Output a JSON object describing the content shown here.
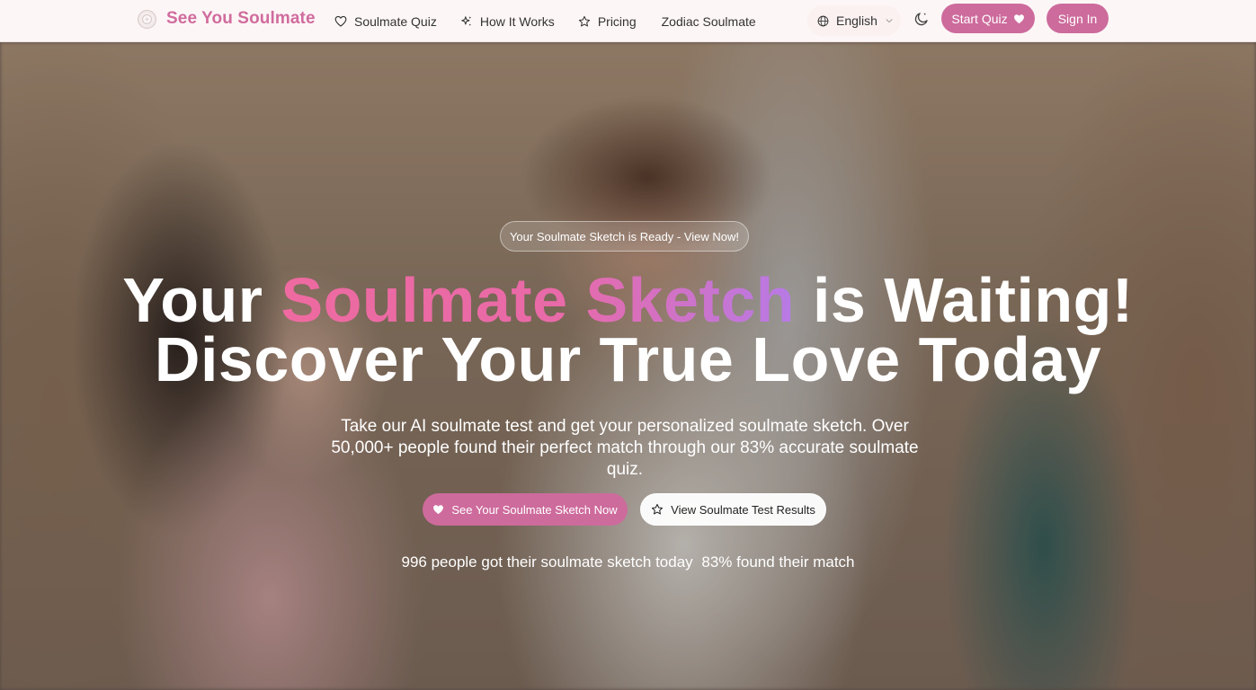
{
  "header": {
    "brand_name": "See You Soulmate",
    "nav": [
      {
        "label": "Soulmate Quiz",
        "icon": "heart-outline-icon"
      },
      {
        "label": "How It Works",
        "icon": "sparkles-icon"
      },
      {
        "label": "Pricing",
        "icon": "star-outline-icon"
      },
      {
        "label": "Zodiac Soulmate",
        "icon": ""
      }
    ],
    "language": "English",
    "start_quiz_label": "Start Quiz",
    "sign_in_label": "Sign In"
  },
  "hero": {
    "badge": "Your Soulmate Sketch is Ready - View Now!",
    "headline": {
      "part1": "Your ",
      "highlight": "Soulmate Sketch",
      "part2": " is Waiting!",
      "line2": "Discover Your True Love Today"
    },
    "subtitle": "Take our AI soulmate test and get your personalized soulmate sketch. Over 50,000+ people found their perfect match through our 83% accurate soulmate quiz.",
    "cta_primary": "See Your Soulmate Sketch Now",
    "cta_secondary": "View Soulmate Test Results",
    "stats": {
      "today": "996 people got their soulmate sketch today",
      "match": "83% found their match"
    }
  },
  "colors": {
    "brand_pink": "#cd6b9c",
    "gradient_start": "#ee6aa0",
    "gradient_end": "#b77ae6",
    "header_bg": "#fdf6f6"
  }
}
